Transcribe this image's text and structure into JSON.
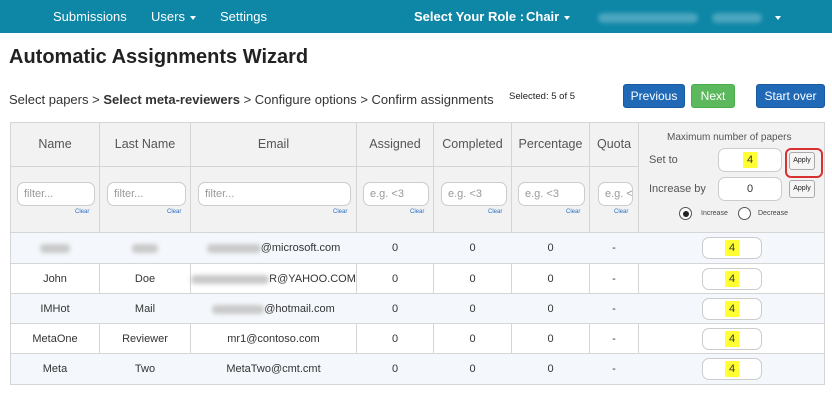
{
  "nav": {
    "submissions": "Submissions",
    "users": "Users",
    "settings": "Settings",
    "role_label": "Select Your Role :",
    "role_value": "Chair"
  },
  "page_title": "Automatic Assignments Wizard",
  "breadcrumb": {
    "step1": "Select papers",
    "sep": ">",
    "step2": "Select meta-reviewers",
    "step3": "Configure options",
    "step4": "Confirm assignments"
  },
  "selected_text": "Selected: 5 of 5",
  "buttons": {
    "previous": "Previous",
    "next": "Next",
    "start_over": "Start over"
  },
  "table": {
    "headers": {
      "name": "Name",
      "last_name": "Last Name",
      "email": "Email",
      "assigned": "Assigned",
      "completed": "Completed",
      "percentage": "Percentage",
      "quota": "Quota"
    },
    "filters": {
      "text_placeholder": "filter...",
      "num_placeholder": "e.g. <3",
      "clear": "Clear"
    },
    "max_panel": {
      "title": "Maximum number of papers",
      "set_to_label": "Set to",
      "set_to_value": "4",
      "increase_by_label": "Increase by",
      "increase_by_value": "0",
      "apply": "Apply",
      "increase": "Increase",
      "decrease": "Decrease"
    },
    "rows": [
      {
        "name": "",
        "last": "",
        "email": "@microsoft.com",
        "assigned": "0",
        "completed": "0",
        "percentage": "0",
        "quota": "-",
        "max": "4"
      },
      {
        "name": "John",
        "last": "Doe",
        "email": "R@YAHOO.COM",
        "assigned": "0",
        "completed": "0",
        "percentage": "0",
        "quota": "-",
        "max": "4"
      },
      {
        "name": "IMHot",
        "last": "Mail",
        "email": "@hotmail.com",
        "assigned": "0",
        "completed": "0",
        "percentage": "0",
        "quota": "-",
        "max": "4"
      },
      {
        "name": "MetaOne",
        "last": "Reviewer",
        "email": "mr1@contoso.com",
        "assigned": "0",
        "completed": "0",
        "percentage": "0",
        "quota": "-",
        "max": "4"
      },
      {
        "name": "Meta",
        "last": "Two",
        "email": "MetaTwo@cmt.cmt",
        "assigned": "0",
        "completed": "0",
        "percentage": "0",
        "quota": "-",
        "max": "4"
      }
    ]
  },
  "colors": {
    "navbar": "#0e86a6",
    "primary_button": "#2069b6",
    "success_button": "#5cb85c",
    "highlight": "#ffff33",
    "apply_ring": "#d93030"
  }
}
